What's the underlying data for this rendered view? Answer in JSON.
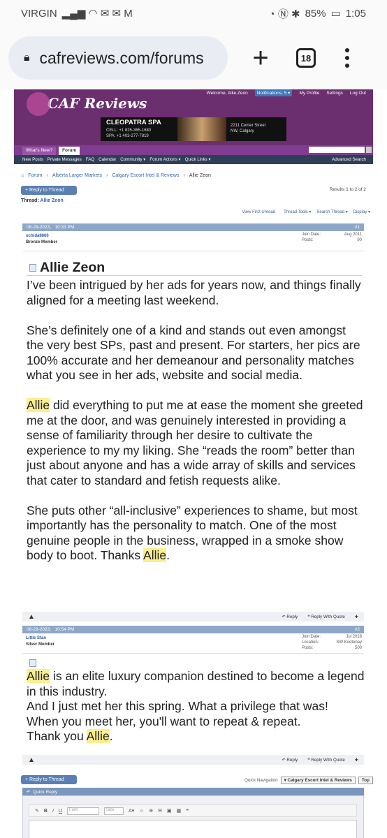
{
  "status_bar": {
    "carrier": "VIRGIN",
    "battery": "85%",
    "time": "1:05"
  },
  "browser": {
    "url": "cafreviews.com/forums",
    "tab_count": "18"
  },
  "header": {
    "logo": "CAF Reviews",
    "welcome": "Welcome, Allie.Zeon",
    "notifications": "Notifications: 5 ▾",
    "links": [
      "My Profile",
      "Settings",
      "Log Out"
    ],
    "ad": {
      "name": "CLEOPATRA SPA",
      "cell": "CELL: +1 825-365-1680",
      "spa": "SPA: +1 403-277-7819",
      "addr1": "2211 Center Street",
      "addr2": "NW, Calgary"
    }
  },
  "nav": {
    "tabs": [
      "What's New?",
      "Forum"
    ],
    "sub": [
      "New Posts",
      "Private Messages",
      "FAQ",
      "Calendar",
      "Community ▾",
      "Forum Actions ▾",
      "Quick Links ▾"
    ],
    "advanced": "Advanced Search"
  },
  "breadcrumb": [
    "Forum",
    "Alberta Larger Markets",
    "Calgary Escort Intel & Reviews",
    "Allie Zeon"
  ],
  "thread": {
    "reply_label": "+ Reply to Thread",
    "results": "Results 1 to 2 of 2",
    "label": "Thread:",
    "title": "Allie Zeon",
    "tools": [
      "View First Unread",
      "Thread Tools ▾",
      "Search Thread ▾",
      "Display ▾"
    ]
  },
  "posts": [
    {
      "date": "08-29-2023,",
      "time": "10:33 PM",
      "num": "#1",
      "user": "uchida8866",
      "rank": "Bronze Member",
      "meta_labels": [
        "Join Date:",
        "Posts:"
      ],
      "meta_values": [
        "Aug 2011",
        "90"
      ],
      "title": "Allie Zeon",
      "p1": "I’ve been intrigued by her ads for years now, and things finally aligned for a meeting last weekend.",
      "p2": "She’s definitely one of a kind and stands out even amongst the very best SPs, past and present. For starters, her pics are 100% accurate and her demeanour and personality matches what you see in her ads, website and social media.",
      "p3_hl": "Allie",
      "p3": " did everything to put me at ease the moment she greeted me at the door, and was genuinely interested in providing a sense of familiarity through her desire to cultivate the experience to my my liking. She “reads the room” better than just about anyone and has a wide array of skills and services that cater to standard and fetish requests alike.",
      "p4": "She puts other “all-inclusive” experiences to shame, but most importantly has the personality to match. One of the most genuine people in the business, wrapped in a smoke show body to boot. Thanks ",
      "p4_hl": "Allie",
      "p4_end": "."
    },
    {
      "date": "08-29-2023,",
      "time": "10:54 PM",
      "num": "#2",
      "user": "Little Stan",
      "rank": "Silver Member",
      "meta_labels": [
        "Join Date:",
        "Location:",
        "Posts:"
      ],
      "meta_values": [
        "Jul 2018",
        "SW Kootenay",
        "500"
      ],
      "l1_hl": "Allie",
      "l1": " is an elite luxury companion destined to become a legend in this industry.",
      "l2": "And I just met her this spring. What a privilege that was!",
      "l3": "When you meet her, you'll want to repeat & repeat.",
      "l4": "Thank you ",
      "l4_hl": "Allie",
      "l4_end": "."
    }
  ],
  "post_footer": {
    "reply": "Reply",
    "quote": "Reply With Quote"
  },
  "bottom": {
    "quick_nav_label": "Quick Navigation",
    "quick_nav_value": "▾ Calgary Escort Intel & Reviews",
    "top": "Top",
    "quick_reply": "Quick Reply",
    "font": "Font",
    "size": "Size"
  }
}
